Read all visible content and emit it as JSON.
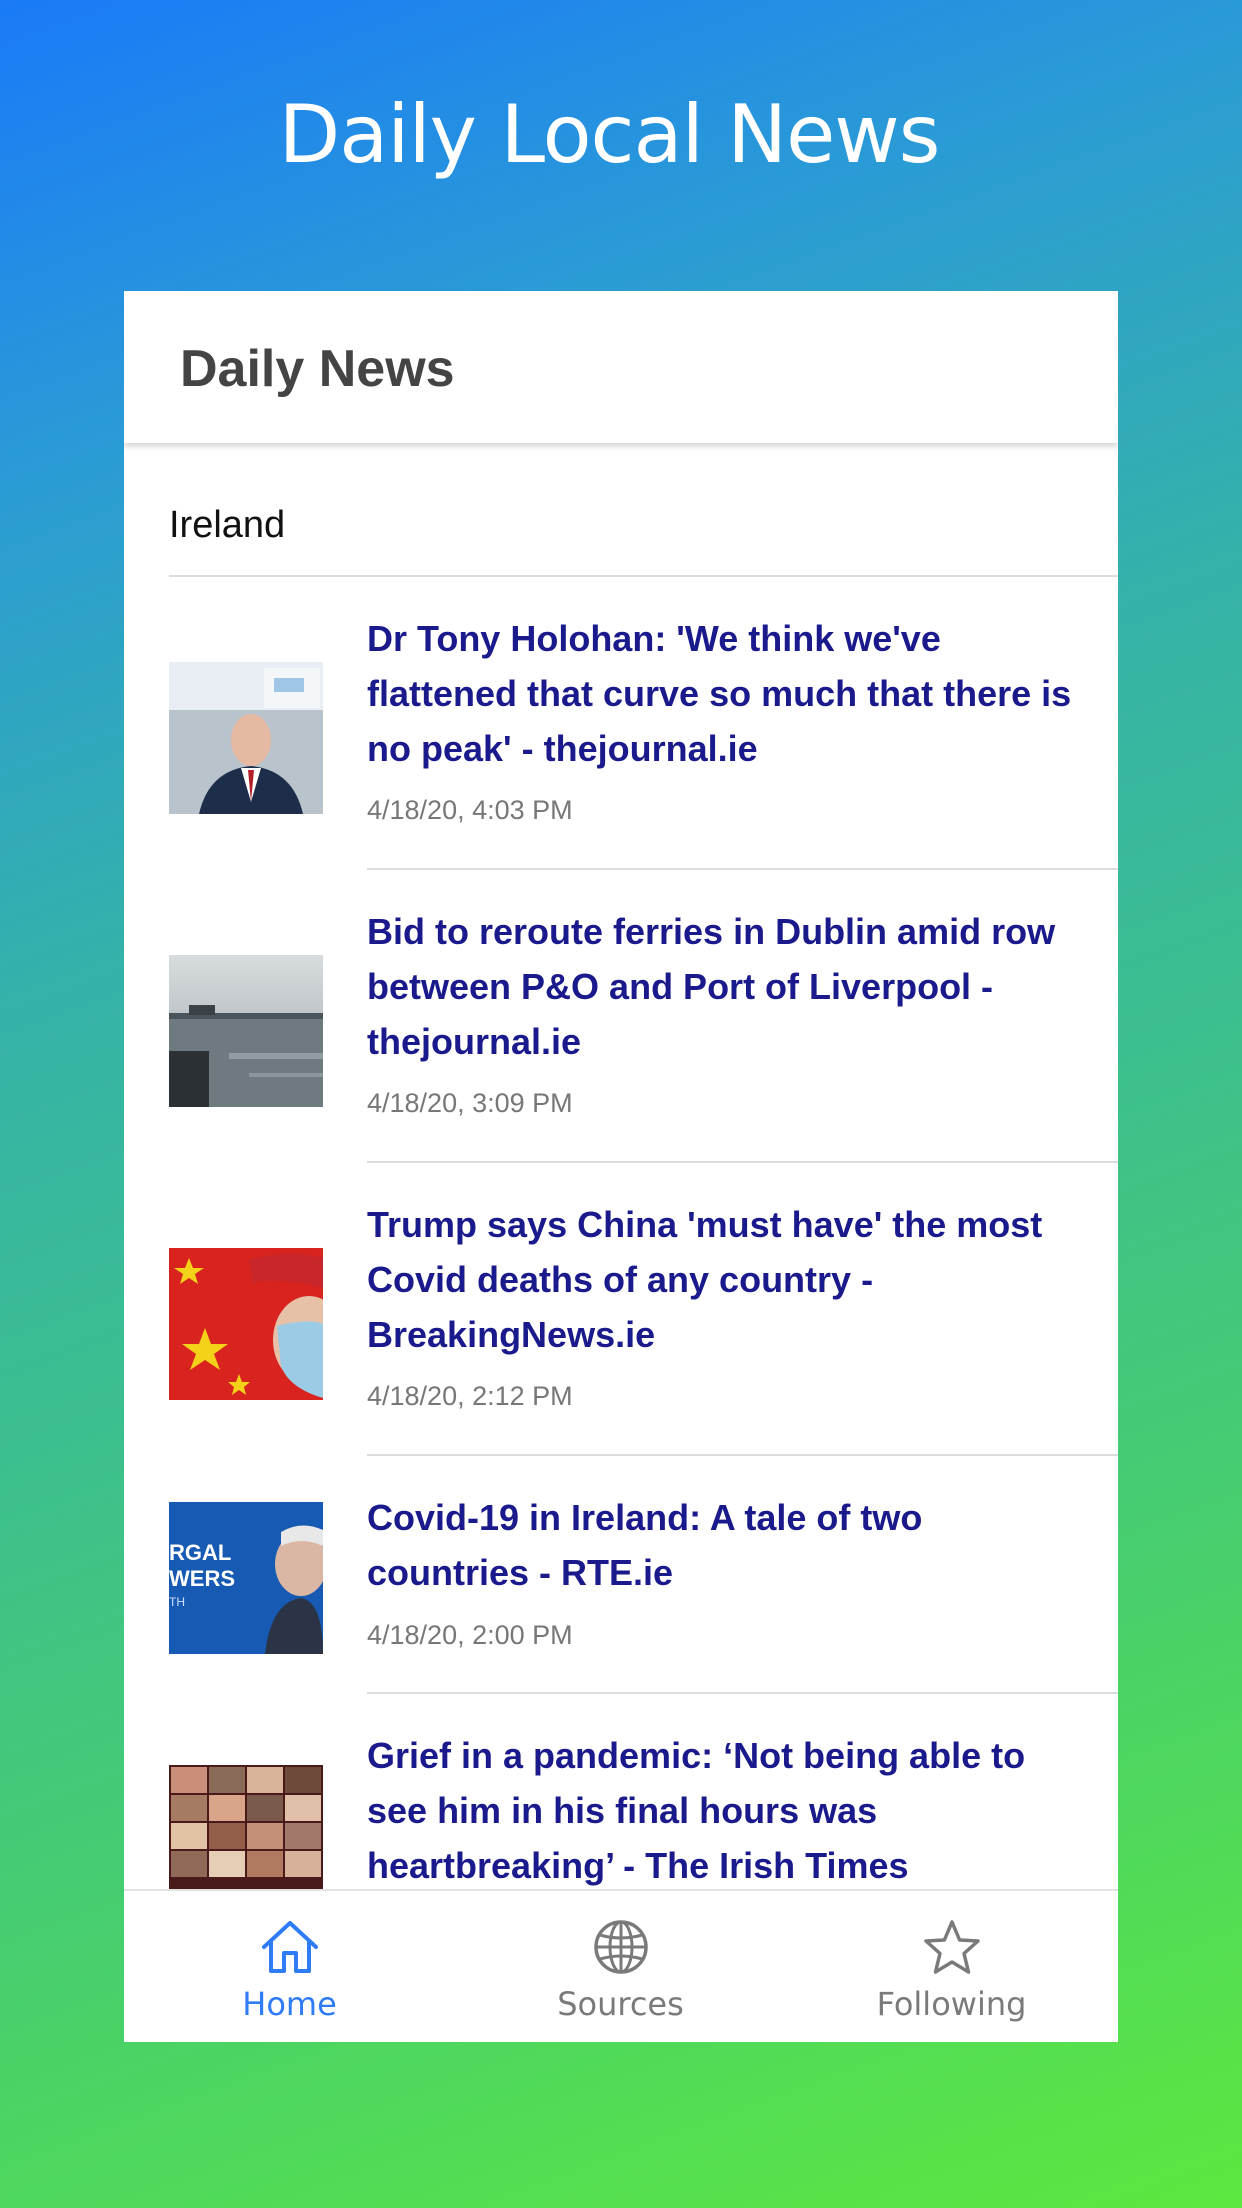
{
  "app": {
    "title": "Daily Local News"
  },
  "nav": {
    "title": "Daily News"
  },
  "section": {
    "label": "Ireland"
  },
  "articles": [
    {
      "headline": "Dr Tony Holohan: 'We think we've flattened that curve so much that there is no peak' - thejournal.ie",
      "timestamp": "4/18/20, 4:03 PM"
    },
    {
      "headline": "Bid to reroute ferries in Dublin amid row between P&O and Port of Liverpool - thejournal.ie",
      "timestamp": "4/18/20, 3:09 PM"
    },
    {
      "headline": "Trump says China 'must have' the most Covid deaths of any country - BreakingNews.ie",
      "timestamp": "4/18/20, 2:12 PM"
    },
    {
      "headline": "Covid-19 in Ireland: A tale of two countries - RTE.ie",
      "timestamp": "4/18/20, 2:00 PM"
    },
    {
      "headline": "Grief in a pandemic: ‘Not being able to see him in his final hours was heartbreaking’ - The Irish Times",
      "timestamp": ""
    }
  ],
  "tabs": [
    {
      "label": "Home",
      "icon": "home-icon",
      "active": true
    },
    {
      "label": "Sources",
      "icon": "globe-icon",
      "active": false
    },
    {
      "label": "Following",
      "icon": "star-icon",
      "active": false
    }
  ],
  "colors": {
    "headline": "#1a1a8c",
    "tab_active": "#2f7cf6",
    "tab_inactive": "#7a7a7a",
    "timestamp": "#777777"
  }
}
